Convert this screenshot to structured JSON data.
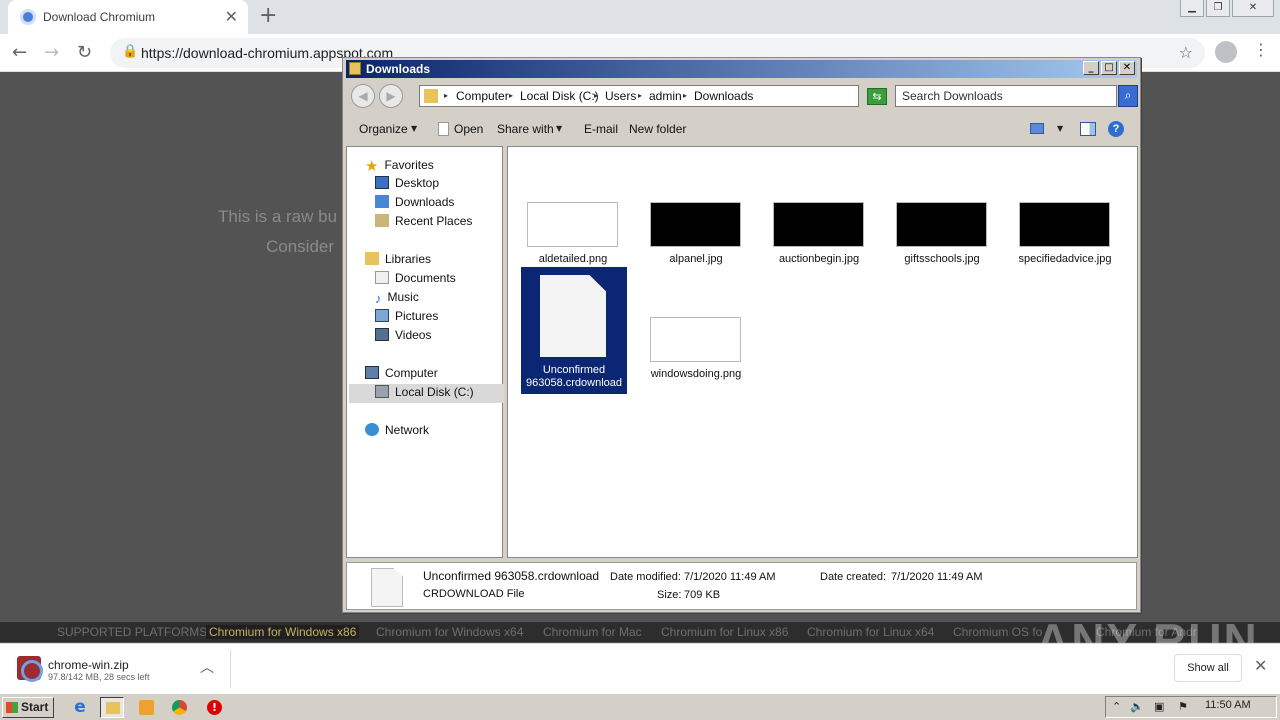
{
  "browser": {
    "tab_title": "Download Chromium",
    "url": "https://download-chromium.appspot.com"
  },
  "page": {
    "line1": "This is a raw bu",
    "line2": "Consider",
    "platforms_label": "SUPPORTED PLATFORMS:",
    "platforms": [
      "Chromium for Windows x86",
      "Chromium for Windows x64",
      "Chromium for Mac",
      "Chromium for Linux x86",
      "Chromium for Linux x64",
      "Chromium OS fo",
      "Chromium for Andr"
    ],
    "watermark": "ANY RUN"
  },
  "download_shelf": {
    "file_name": "chrome-win.zip",
    "status": "97.8/142 MB, 28 secs left",
    "show_all": "Show all"
  },
  "explorer": {
    "title": "Downloads",
    "breadcrumbs": [
      "Computer",
      "Local Disk (C:)",
      "Users",
      "admin",
      "Downloads"
    ],
    "search_placeholder": "Search Downloads",
    "commands": {
      "organize": "Organize",
      "open": "Open",
      "share_with": "Share with",
      "email": "E-mail",
      "new_folder": "New folder"
    },
    "nav": {
      "favorites": "Favorites",
      "desktop": "Desktop",
      "downloads": "Downloads",
      "recent_places": "Recent Places",
      "libraries": "Libraries",
      "documents": "Documents",
      "music": "Music",
      "pictures": "Pictures",
      "videos": "Videos",
      "computer": "Computer",
      "local_disk": "Local Disk (C:)",
      "network": "Network"
    },
    "files": [
      {
        "name": "aldetailed.png"
      },
      {
        "name": "alpanel.jpg"
      },
      {
        "name": "auctionbegin.jpg"
      },
      {
        "name": "giftsschools.jpg"
      },
      {
        "name": "specifiedadvice.jpg"
      },
      {
        "name_line1": "Unconfirmed",
        "name_line2": "963058.crdownload"
      },
      {
        "name": "windowsdoing.png"
      }
    ],
    "details": {
      "name": "Unconfirmed 963058.crdownload",
      "type": "CRDOWNLOAD File",
      "date_modified_label": "Date modified:",
      "date_modified": "7/1/2020 11:49 AM",
      "date_created_label": "Date created:",
      "date_created": "7/1/2020 11:49 AM",
      "size_label": "Size:",
      "size": "709 KB"
    }
  },
  "taskbar": {
    "start": "Start",
    "clock": "11:50 AM"
  }
}
